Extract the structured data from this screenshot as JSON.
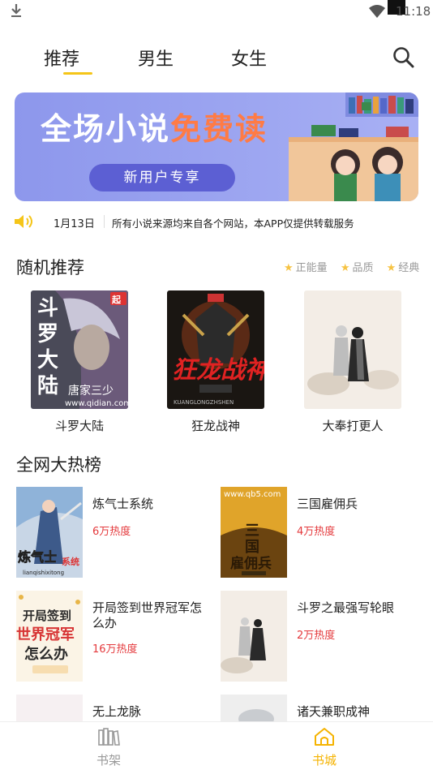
{
  "status": {
    "time": "11:18"
  },
  "tabs": [
    {
      "label": "推荐"
    },
    {
      "label": "男生"
    },
    {
      "label": "女生"
    }
  ],
  "banner": {
    "title_white": "全场小说",
    "title_highlight": "免费读",
    "cta": "新用户专享"
  },
  "notice": {
    "date": "1月13日",
    "message": "所有小说来源均来自各个网站，本APP仅提供转载服务"
  },
  "random": {
    "title": "随机推荐",
    "tags": [
      "正能量",
      "品质",
      "经典"
    ],
    "books": [
      {
        "name": "斗罗大陆"
      },
      {
        "name": "狂龙战神"
      },
      {
        "name": "大奉打更人"
      }
    ]
  },
  "hot": {
    "title": "全网大热榜",
    "books": [
      {
        "name": "炼气士系统",
        "heat": "6万热度"
      },
      {
        "name": "三国雇佣兵",
        "heat": "4万热度"
      },
      {
        "name": "开局签到世界冠军怎么办",
        "heat": "16万热度"
      },
      {
        "name": "斗罗之最强写轮眼",
        "heat": "2万热度"
      },
      {
        "name": "无上龙脉",
        "heat": ""
      },
      {
        "name": "诸天兼职成神",
        "heat": ""
      }
    ]
  },
  "covers": {
    "douluo": {
      "side_text": "斗罗大陆",
      "url": "www.qidian.com",
      "author": "唐家三少"
    },
    "kuanglong": {
      "title": "狂龙战神",
      "sub": "KUANGLONGZHSHEN"
    },
    "lianqi": {
      "title": "炼气士",
      "badge": "系统",
      "pinyin": "lianqishixitong"
    },
    "sanguo": {
      "url": "www.qb5.com",
      "title": "三国雇佣兵"
    },
    "kaiju": {
      "title1": "开局签到",
      "title2": "世界冠军",
      "title3": "怎么办"
    }
  },
  "bottom_nav": [
    {
      "label": "书架"
    },
    {
      "label": "书城"
    }
  ],
  "colors": {
    "accent": "#f5c518",
    "heat": "#e4393c",
    "banner": "#8d97ec"
  }
}
